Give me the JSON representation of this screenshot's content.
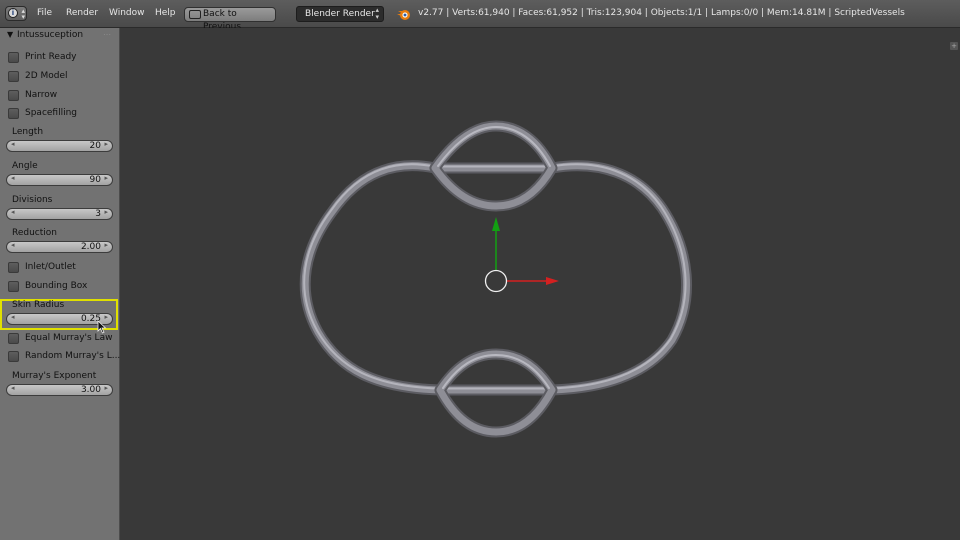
{
  "topbar": {
    "menu": [
      "File",
      "Render",
      "Window",
      "Help"
    ],
    "back_button": "Back to Previous",
    "render_engine": "Blender Render",
    "stats": "v2.77 | Verts:61,940 | Faces:61,952 | Tris:123,904 | Objects:1/1 | Lamps:0/0 | Mem:14.81M | ScriptedVessels"
  },
  "panel": {
    "title": "Intussuception",
    "checkboxes_top": [
      {
        "label": "Print Ready",
        "checked": false
      },
      {
        "label": "2D Model",
        "checked": false
      },
      {
        "label": "Narrow",
        "checked": false
      },
      {
        "label": "Spacefilling",
        "checked": false
      }
    ],
    "fields": [
      {
        "label": "Length",
        "value": "20"
      },
      {
        "label": "Angle",
        "value": "90"
      },
      {
        "label": "Divisions",
        "value": "3"
      },
      {
        "label": "Reduction",
        "value": "2.00"
      }
    ],
    "checkboxes_mid": [
      {
        "label": "Inlet/Outlet",
        "checked": false
      },
      {
        "label": "Bounding Box",
        "checked": false
      }
    ],
    "skin_radius": {
      "label": "Skin Radius",
      "value": "0.25"
    },
    "checkboxes_bottom": [
      {
        "label": "Equal Murray's Law",
        "checked": false
      },
      {
        "label": "Random Murray's L...",
        "checked": false
      }
    ],
    "murray_exponent": {
      "label": "Murray's Exponent",
      "value": "3.00"
    }
  },
  "colors": {
    "highlight": "#e0e000",
    "axis_x": "#d42020",
    "axis_y": "#12a012",
    "mesh": "#8e8e96"
  }
}
